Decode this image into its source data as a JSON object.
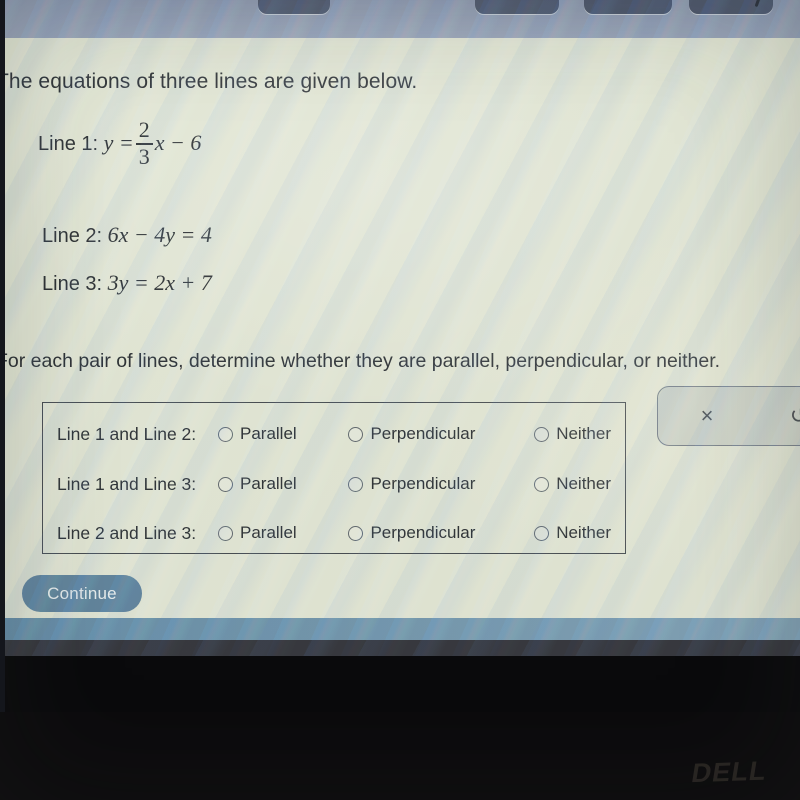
{
  "question": {
    "intro": "The equations of three lines are given below.",
    "lines": [
      {
        "label": "Line 1:",
        "lhs": "y =",
        "frac_num": "2",
        "frac_den": "3",
        "rhs": "x − 6"
      },
      {
        "label": "Line 2:",
        "expr": "6x − 4y = 4"
      },
      {
        "label": "Line 3:",
        "expr": "3y = 2x + 7"
      }
    ],
    "instruction": "For each pair of lines, determine whether they are parallel, perpendicular, or neither."
  },
  "answer_table": {
    "rows": [
      {
        "pair": "Line 1 and Line 2:",
        "options": [
          "Parallel",
          "Perpendicular",
          "Neither"
        ],
        "selected": null
      },
      {
        "pair": "Line 1 and Line 3:",
        "options": [
          "Parallel",
          "Perpendicular",
          "Neither"
        ],
        "selected": null
      },
      {
        "pair": "Line 2 and Line 3:",
        "options": [
          "Parallel",
          "Perpendicular",
          "Neither"
        ],
        "selected": null
      }
    ]
  },
  "tool_palette": {
    "clear_icon": "×",
    "clear_name": "clear-icon",
    "undo_icon": "↺",
    "undo_name": "undo-icon"
  },
  "actions": {
    "continue_label": "Continue"
  },
  "taskbar": {
    "icons": [
      {
        "name": "google-sheets-icon",
        "color": "#1f9c77"
      },
      {
        "name": "google-slides-icon",
        "color": "#e8b22b"
      },
      {
        "name": "google-drive-icon",
        "color": "#2f9e57"
      },
      {
        "name": "google-classroom-icon",
        "color": "#3b7a52"
      },
      {
        "name": "gmail-icon",
        "color": "#d2453b"
      }
    ]
  },
  "device": {
    "brand": "DELL"
  },
  "colors": {
    "page_bg": "#e7ead9",
    "chrome": "#8d98b4",
    "chrome_button": "#454e68",
    "status_band": "#6e93ad",
    "continue_bg": "#5a7f9c",
    "taskbar": "#2a2a33",
    "text": "#21242b"
  }
}
